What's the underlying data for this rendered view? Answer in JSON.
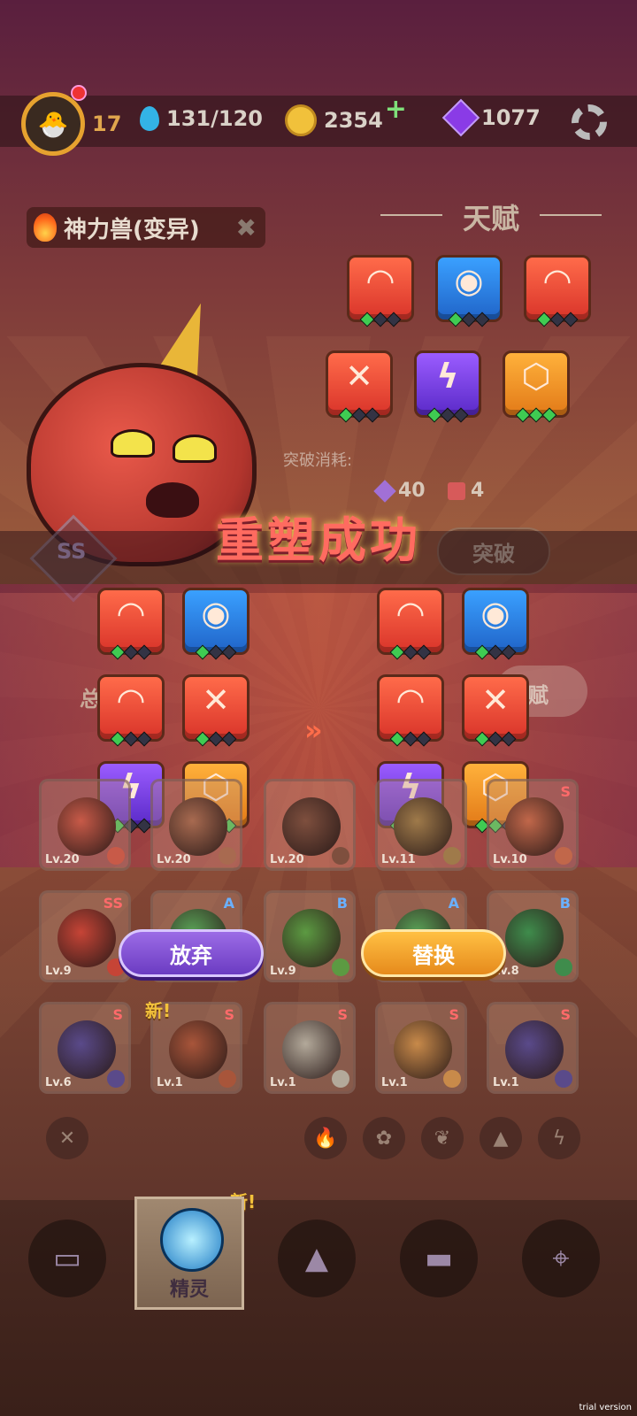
{
  "hud": {
    "level": "17",
    "energy": "131/120",
    "coins": "2354",
    "gems": "1077"
  },
  "monster": {
    "name": "神力兽(变异)",
    "grade": "SS"
  },
  "talent": {
    "title": "天赋",
    "cost_label": "突破消耗:",
    "cost_gem": "40",
    "cost_item": "4",
    "breakthrough_label": "突破"
  },
  "modal": {
    "title": "重塑成功",
    "arrow": "»",
    "abandon_label": "放弃",
    "replace_label": "替换",
    "left_icons": [
      {
        "color": "red",
        "glyph": "◠",
        "level": 1
      },
      {
        "color": "blue",
        "glyph": "◉",
        "level": 1
      },
      {
        "color": "red",
        "glyph": "◠",
        "level": 1
      },
      {
        "color": "red",
        "glyph": "✕",
        "level": 1
      },
      {
        "color": "purple",
        "glyph": "ϟ",
        "level": 1
      },
      {
        "color": "orange",
        "glyph": "⬡",
        "level": 3
      }
    ],
    "right_icons": [
      {
        "color": "red",
        "glyph": "◠",
        "level": 1
      },
      {
        "color": "blue",
        "glyph": "◉",
        "level": 1
      },
      {
        "color": "red",
        "glyph": "◠",
        "level": 1
      },
      {
        "color": "red",
        "glyph": "✕",
        "level": 1
      },
      {
        "color": "purple",
        "glyph": "ϟ",
        "level": 1
      },
      {
        "color": "orange",
        "glyph": "⬡",
        "level": 2
      }
    ]
  },
  "partial_labels": {
    "left_hidden": "总",
    "right_hidden": "赋"
  },
  "cards_row1": [
    {
      "lv": "Lv.20",
      "rank": "",
      "color": "#c85a48"
    },
    {
      "lv": "Lv.20",
      "rank": "",
      "color": "#a86a50"
    },
    {
      "lv": "Lv.20",
      "rank": "",
      "color": "#7e4f3e"
    },
    {
      "lv": "Lv.11",
      "rank": "",
      "color": "#9f7a4a"
    },
    {
      "lv": "Lv.10",
      "rank": "S",
      "color": "#c1674a"
    }
  ],
  "cards_row2": [
    {
      "lv": "Lv.9",
      "rank": "SS",
      "color": "#c64436"
    },
    {
      "lv": "",
      "rank": "A",
      "color": "#5aa257"
    },
    {
      "lv": "Lv.9",
      "rank": "B",
      "color": "#5c9a42"
    },
    {
      "lv": "",
      "rank": "A",
      "color": "#5aa257"
    },
    {
      "lv": "Lv.8",
      "rank": "B",
      "color": "#3f8c4c"
    }
  ],
  "cards_row3": [
    {
      "lv": "Lv.6",
      "rank": "S",
      "color": "#5a4a8a"
    },
    {
      "lv": "Lv.1",
      "rank": "S",
      "color": "#a8553a"
    },
    {
      "lv": "Lv.1",
      "rank": "S",
      "color": "#b3a99a"
    },
    {
      "lv": "Lv.1",
      "rank": "S",
      "color": "#c88a4a"
    },
    {
      "lv": "Lv.1",
      "rank": "S",
      "color": "#5a4a8a"
    }
  ],
  "new_label": "新!",
  "nav": {
    "active_label": "精灵"
  },
  "watermark": "trial version"
}
